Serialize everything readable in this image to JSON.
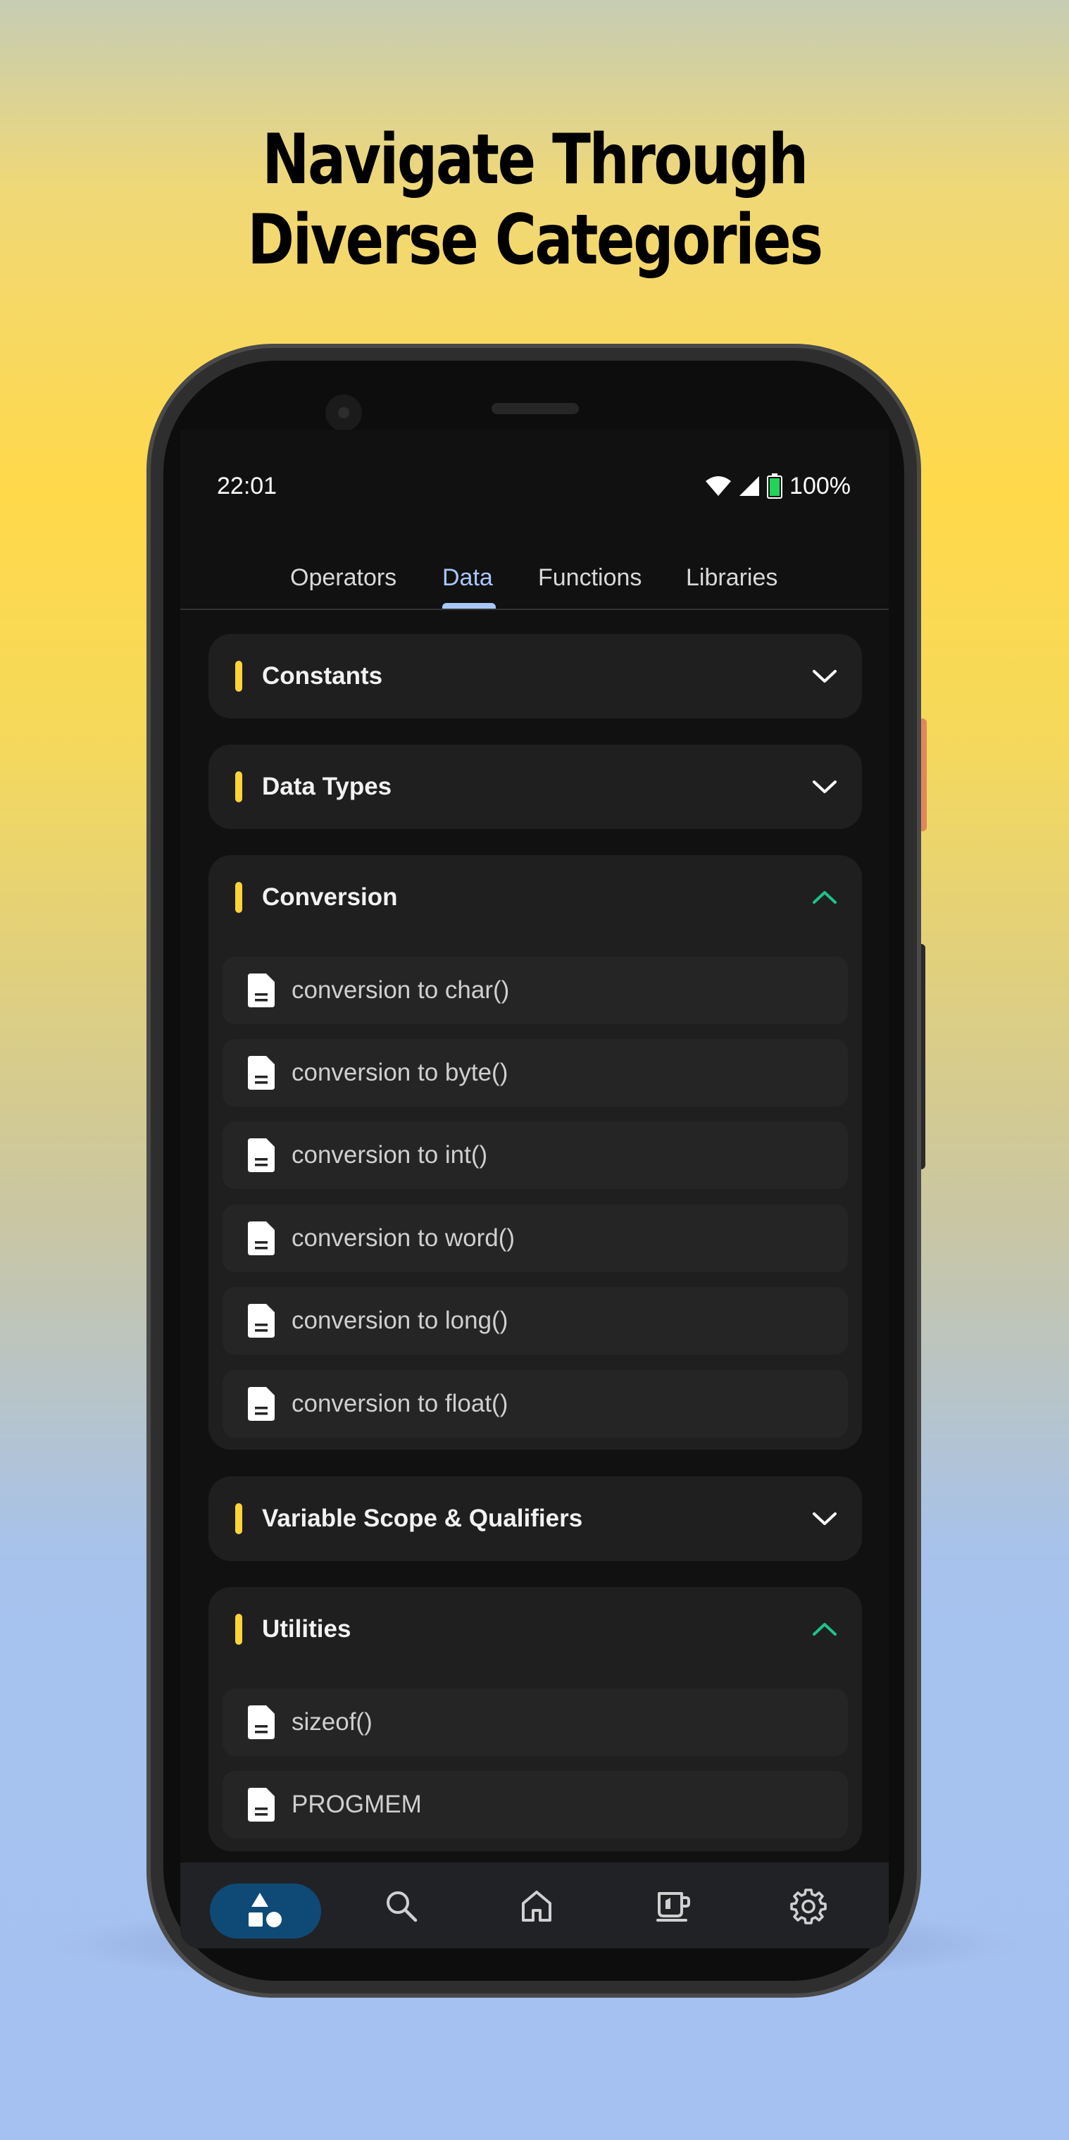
{
  "headline": {
    "line1": "Navigate Through",
    "line2": "Diverse Categories"
  },
  "status": {
    "time": "22:01",
    "battery": "100%"
  },
  "tabs": [
    {
      "label": "Operators"
    },
    {
      "label": "Data"
    },
    {
      "label": "Functions"
    },
    {
      "label": "Libraries"
    }
  ],
  "active_tab": "Data",
  "sections": [
    {
      "title": "Constants",
      "expanded": false,
      "items": []
    },
    {
      "title": "Data Types",
      "expanded": false,
      "items": []
    },
    {
      "title": "Conversion",
      "expanded": true,
      "items": [
        {
          "label": "conversion to char()"
        },
        {
          "label": "conversion to byte()"
        },
        {
          "label": "conversion to int()"
        },
        {
          "label": "conversion to word()"
        },
        {
          "label": "conversion to long()"
        },
        {
          "label": "conversion to float()"
        }
      ]
    },
    {
      "title": "Variable Scope & Qualifiers",
      "expanded": false,
      "items": []
    },
    {
      "title": "Utilities",
      "expanded": true,
      "items": [
        {
          "label": "sizeof()"
        },
        {
          "label": "PROGMEM"
        }
      ]
    }
  ],
  "nav": [
    {
      "icon": "categories-icon",
      "active": true
    },
    {
      "icon": "search-icon",
      "active": false
    },
    {
      "icon": "home-icon",
      "active": false
    },
    {
      "icon": "coffee-cup-icon",
      "active": false
    },
    {
      "icon": "gear-icon",
      "active": false
    }
  ],
  "colors": {
    "accent_yellow": "#ffd43b",
    "tab_active": "#a8c7fa",
    "expanded_chevron": "#1fc28b",
    "nav_active_pill": "#0f4a77"
  }
}
